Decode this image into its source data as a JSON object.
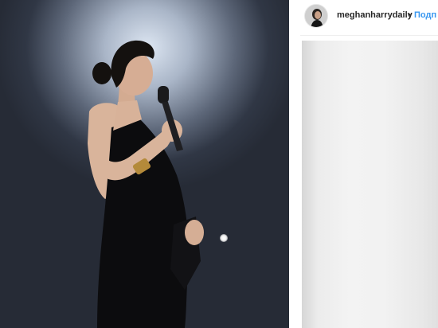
{
  "post": {
    "username": "meghanharrydaily",
    "separator": "•",
    "follow_label": "Подп"
  },
  "photo": {
    "subject": "woman-speaking-on-stage"
  },
  "colors": {
    "follow": "#3897f0",
    "username": "#262626",
    "divider": "#efefef"
  },
  "icons": {
    "avatar": "profile-avatar"
  }
}
